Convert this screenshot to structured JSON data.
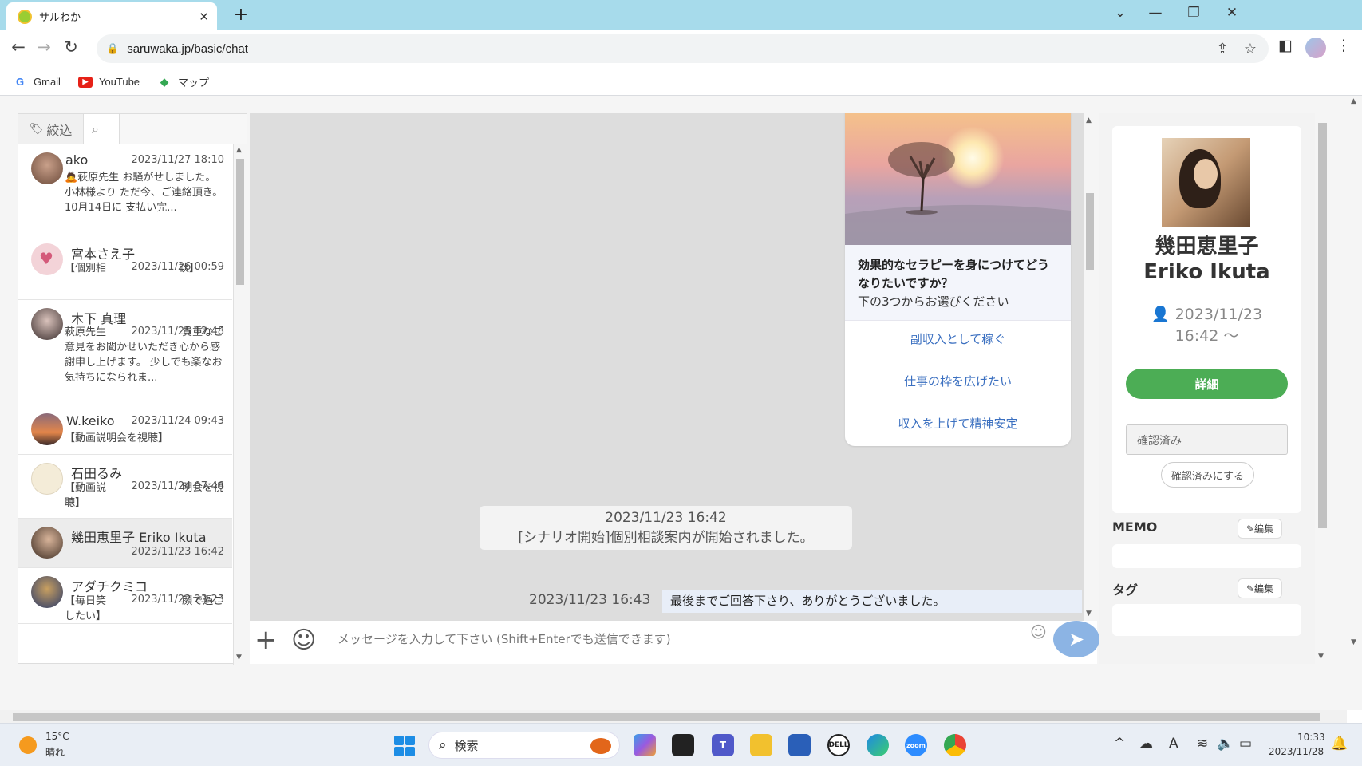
{
  "browser": {
    "tab_title": "サルわか",
    "tab_close": "✕",
    "new_tab": "+",
    "url": "saruwaka.jp/basic/chat",
    "bookmarks": [
      {
        "label": "Gmail",
        "icon": "G"
      },
      {
        "label": "YouTube",
        "icon": "▶"
      },
      {
        "label": "マップ",
        "icon": "◆"
      }
    ]
  },
  "left_panel": {
    "filter_label": "絞込",
    "contacts": [
      {
        "name": "ako",
        "date": "2023/11/27 18:10",
        "preview": "🙇萩原先生 お騒がせしました。 小林様より ただ今、ご連絡頂き。 10月14日に 支払い完..."
      },
      {
        "name": "宮本さえ子",
        "date": "2023/11/26 00:59",
        "preview": "【個別相　　　　　　　談】"
      },
      {
        "name": "木下 真理",
        "date": "2023/11/25 12:48",
        "preview": "萩原先生　　　　　　　 貴重なご意見をお聞かせいただき心から感謝申し上げます。 少しでも楽なお気持ちになられま..."
      },
      {
        "name": "W.keiko",
        "date": "2023/11/24 09:43",
        "preview": "【動画説明会を視聴】"
      },
      {
        "name": "石田るみ",
        "date": "2023/11/24 07:46",
        "preview": "【動画説　　　　　　　 明会を視聴】"
      },
      {
        "name": "幾田恵里子 Eriko Ikuta",
        "date": "2023/11/23 16:42",
        "preview": ""
      },
      {
        "name": "アダチクミコ",
        "date": "2023/11/22 23:23",
        "preview": "【毎日笑　　　　　　　 顔で過ごしたい】"
      }
    ]
  },
  "chat": {
    "card": {
      "title": "効果的なセラピーを身につけてどうなりたいですか？",
      "subtitle": "下の3つからお選びください",
      "options": [
        "副収入として稼ぐ",
        "仕事の枠を広げたい",
        "収入を上げて精神安定"
      ]
    },
    "system_message": {
      "time": "2023/11/23 16:42",
      "text": "[シナリオ開始]個別相談案内が開始されました。"
    },
    "last_message": {
      "time": "2023/11/23 16:43",
      "text": "最後までご回答下さり、ありがとうございました。"
    },
    "composer_placeholder": "メッセージを入力して下さい (Shift+Enterでも送信できます)"
  },
  "right_panel": {
    "name_jp": "幾田恵里子",
    "name_en": "Eriko Ikuta",
    "registered_date": "2023/11/23",
    "registered_time": "16:42 ～",
    "detail_button": "詳細",
    "status_value": "確認済み",
    "confirm_button": "確認済みにする",
    "memo_title": "MEMO",
    "tag_title": "タグ",
    "edit_label": "編集"
  },
  "taskbar": {
    "temperature": "15°C",
    "weather": "晴れ",
    "search_label": "検索",
    "time": "10:33",
    "date": "2023/11/28"
  },
  "colors": {
    "titlebar": "#a7dbeb",
    "detail_button": "#4cad55",
    "send_button": "#8cb4e4",
    "option_link": "#3a6fc0"
  }
}
